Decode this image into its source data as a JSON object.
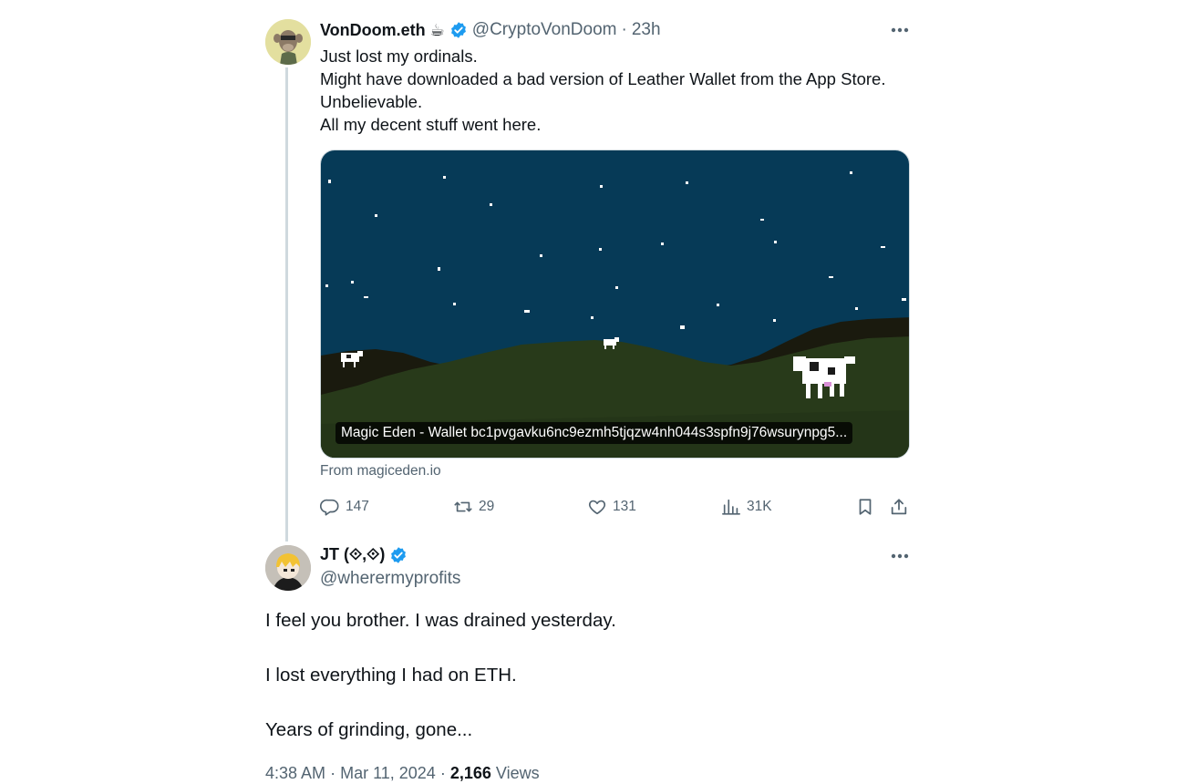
{
  "tweet": {
    "display_name": "VonDoom.eth",
    "name_emoji": "☕",
    "handle": "@CryptoVonDoom",
    "separator": "·",
    "time": "23h",
    "lines": [
      "Just lost my ordinals.",
      "Might have downloaded a bad version of Leather Wallet from the App Store.",
      "Unbelievable.",
      "All my decent stuff went here."
    ],
    "card_caption": "Magic Eden - Wallet bc1pvgavku6nc9ezmh5tjqzw4nh044s3spfn9j76wsurynpg5...",
    "card_source": "From magiceden.io",
    "replies": "147",
    "reposts": "29",
    "likes": "131",
    "views": "31K"
  },
  "reply": {
    "display_name": "JT (⟐,⟐)",
    "handle": "@wherermyprofits",
    "paragraphs": [
      "I feel you brother. I was drained yesterday.",
      "I lost everything I had on ETH.",
      "Years of grinding, gone..."
    ],
    "time": "4:38 AM",
    "date": "Mar 11, 2024",
    "view_count": "2,166",
    "views_label": "Views",
    "dot": "·"
  },
  "colors": {
    "verified": "#1d9bf0",
    "muted": "#536471",
    "thread_line": "#cfd9de",
    "sky": "#063a57",
    "hills": "#2a3a1a"
  }
}
